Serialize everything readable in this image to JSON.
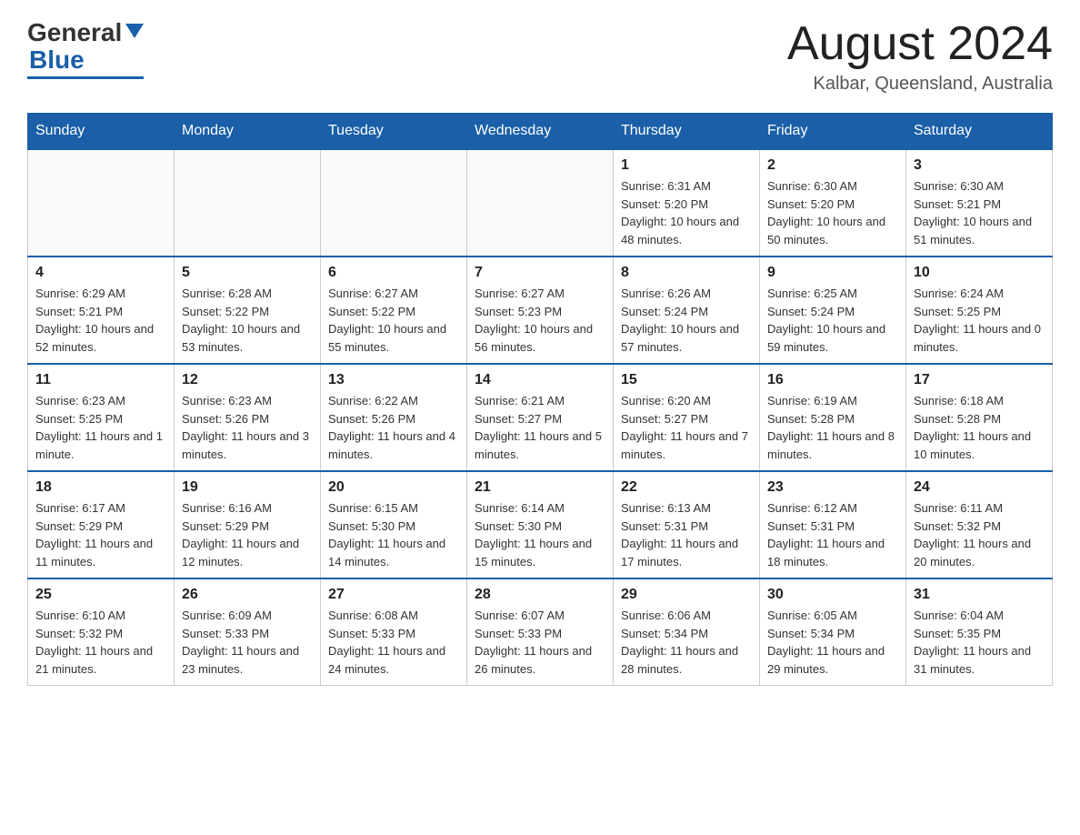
{
  "header": {
    "logo_general": "General",
    "logo_blue": "Blue",
    "month_title": "August 2024",
    "location": "Kalbar, Queensland, Australia"
  },
  "days_of_week": [
    "Sunday",
    "Monday",
    "Tuesday",
    "Wednesday",
    "Thursday",
    "Friday",
    "Saturday"
  ],
  "weeks": [
    [
      {
        "day": "",
        "info": ""
      },
      {
        "day": "",
        "info": ""
      },
      {
        "day": "",
        "info": ""
      },
      {
        "day": "",
        "info": ""
      },
      {
        "day": "1",
        "info": "Sunrise: 6:31 AM\nSunset: 5:20 PM\nDaylight: 10 hours and 48 minutes."
      },
      {
        "day": "2",
        "info": "Sunrise: 6:30 AM\nSunset: 5:20 PM\nDaylight: 10 hours and 50 minutes."
      },
      {
        "day": "3",
        "info": "Sunrise: 6:30 AM\nSunset: 5:21 PM\nDaylight: 10 hours and 51 minutes."
      }
    ],
    [
      {
        "day": "4",
        "info": "Sunrise: 6:29 AM\nSunset: 5:21 PM\nDaylight: 10 hours and 52 minutes."
      },
      {
        "day": "5",
        "info": "Sunrise: 6:28 AM\nSunset: 5:22 PM\nDaylight: 10 hours and 53 minutes."
      },
      {
        "day": "6",
        "info": "Sunrise: 6:27 AM\nSunset: 5:22 PM\nDaylight: 10 hours and 55 minutes."
      },
      {
        "day": "7",
        "info": "Sunrise: 6:27 AM\nSunset: 5:23 PM\nDaylight: 10 hours and 56 minutes."
      },
      {
        "day": "8",
        "info": "Sunrise: 6:26 AM\nSunset: 5:24 PM\nDaylight: 10 hours and 57 minutes."
      },
      {
        "day": "9",
        "info": "Sunrise: 6:25 AM\nSunset: 5:24 PM\nDaylight: 10 hours and 59 minutes."
      },
      {
        "day": "10",
        "info": "Sunrise: 6:24 AM\nSunset: 5:25 PM\nDaylight: 11 hours and 0 minutes."
      }
    ],
    [
      {
        "day": "11",
        "info": "Sunrise: 6:23 AM\nSunset: 5:25 PM\nDaylight: 11 hours and 1 minute."
      },
      {
        "day": "12",
        "info": "Sunrise: 6:23 AM\nSunset: 5:26 PM\nDaylight: 11 hours and 3 minutes."
      },
      {
        "day": "13",
        "info": "Sunrise: 6:22 AM\nSunset: 5:26 PM\nDaylight: 11 hours and 4 minutes."
      },
      {
        "day": "14",
        "info": "Sunrise: 6:21 AM\nSunset: 5:27 PM\nDaylight: 11 hours and 5 minutes."
      },
      {
        "day": "15",
        "info": "Sunrise: 6:20 AM\nSunset: 5:27 PM\nDaylight: 11 hours and 7 minutes."
      },
      {
        "day": "16",
        "info": "Sunrise: 6:19 AM\nSunset: 5:28 PM\nDaylight: 11 hours and 8 minutes."
      },
      {
        "day": "17",
        "info": "Sunrise: 6:18 AM\nSunset: 5:28 PM\nDaylight: 11 hours and 10 minutes."
      }
    ],
    [
      {
        "day": "18",
        "info": "Sunrise: 6:17 AM\nSunset: 5:29 PM\nDaylight: 11 hours and 11 minutes."
      },
      {
        "day": "19",
        "info": "Sunrise: 6:16 AM\nSunset: 5:29 PM\nDaylight: 11 hours and 12 minutes."
      },
      {
        "day": "20",
        "info": "Sunrise: 6:15 AM\nSunset: 5:30 PM\nDaylight: 11 hours and 14 minutes."
      },
      {
        "day": "21",
        "info": "Sunrise: 6:14 AM\nSunset: 5:30 PM\nDaylight: 11 hours and 15 minutes."
      },
      {
        "day": "22",
        "info": "Sunrise: 6:13 AM\nSunset: 5:31 PM\nDaylight: 11 hours and 17 minutes."
      },
      {
        "day": "23",
        "info": "Sunrise: 6:12 AM\nSunset: 5:31 PM\nDaylight: 11 hours and 18 minutes."
      },
      {
        "day": "24",
        "info": "Sunrise: 6:11 AM\nSunset: 5:32 PM\nDaylight: 11 hours and 20 minutes."
      }
    ],
    [
      {
        "day": "25",
        "info": "Sunrise: 6:10 AM\nSunset: 5:32 PM\nDaylight: 11 hours and 21 minutes."
      },
      {
        "day": "26",
        "info": "Sunrise: 6:09 AM\nSunset: 5:33 PM\nDaylight: 11 hours and 23 minutes."
      },
      {
        "day": "27",
        "info": "Sunrise: 6:08 AM\nSunset: 5:33 PM\nDaylight: 11 hours and 24 minutes."
      },
      {
        "day": "28",
        "info": "Sunrise: 6:07 AM\nSunset: 5:33 PM\nDaylight: 11 hours and 26 minutes."
      },
      {
        "day": "29",
        "info": "Sunrise: 6:06 AM\nSunset: 5:34 PM\nDaylight: 11 hours and 28 minutes."
      },
      {
        "day": "30",
        "info": "Sunrise: 6:05 AM\nSunset: 5:34 PM\nDaylight: 11 hours and 29 minutes."
      },
      {
        "day": "31",
        "info": "Sunrise: 6:04 AM\nSunset: 5:35 PM\nDaylight: 11 hours and 31 minutes."
      }
    ]
  ]
}
